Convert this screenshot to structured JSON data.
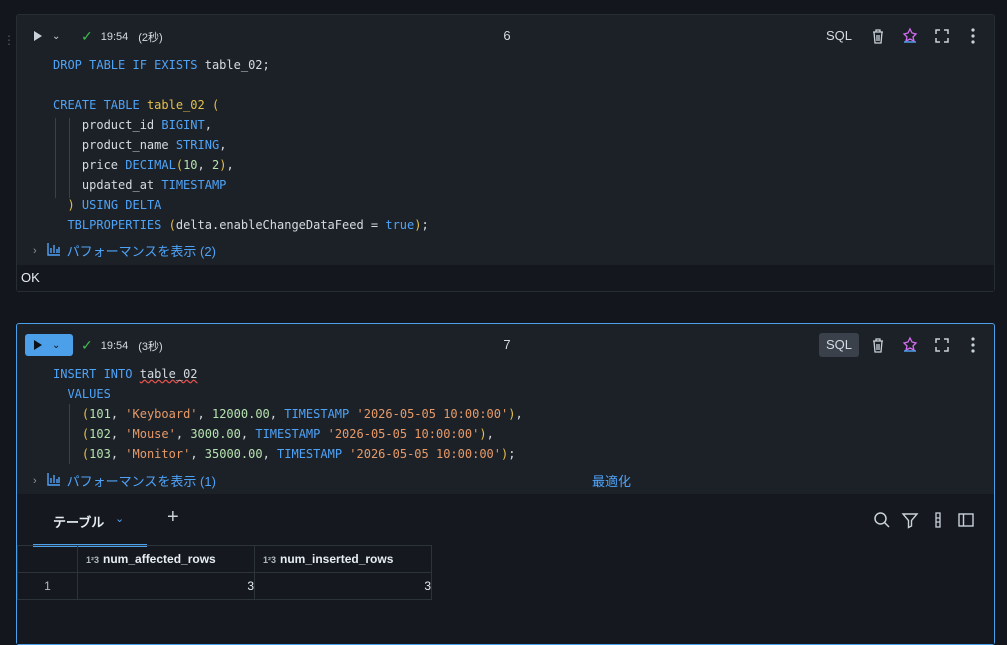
{
  "cell6": {
    "time": "19:54",
    "duration": "(2秒)",
    "number": "6",
    "lang": "SQL",
    "performance_label": "パフォーマンスを表示 (2)",
    "output": "OK"
  },
  "cell7": {
    "time": "19:54",
    "duration": "(3秒)",
    "number": "7",
    "lang": "SQL",
    "performance_label": "パフォーマンスを表示 (1)",
    "optimize_label": "最適化",
    "results": {
      "tab_label": "テーブル",
      "add_label": "+",
      "columns": [
        "num_affected_rows",
        "num_inserted_rows"
      ],
      "column_type": "1²3",
      "rows": [
        {
          "index": "1",
          "values": [
            "3",
            "3"
          ]
        }
      ]
    }
  },
  "icons": [
    "play-icon",
    "chevron-down-icon",
    "check-icon",
    "trash-icon",
    "assistant-icon",
    "expand-icon",
    "kebab-menu-icon",
    "chart-bars-icon",
    "search-icon",
    "filter-icon",
    "column-settings-icon",
    "panel-icon"
  ],
  "colors": {
    "accent": "#4c9fe9",
    "success": "#3fb950",
    "keyword": "#4fa3f7",
    "string": "#e79a68",
    "number": "#b6e3b0",
    "paren": "#e5c04a"
  }
}
